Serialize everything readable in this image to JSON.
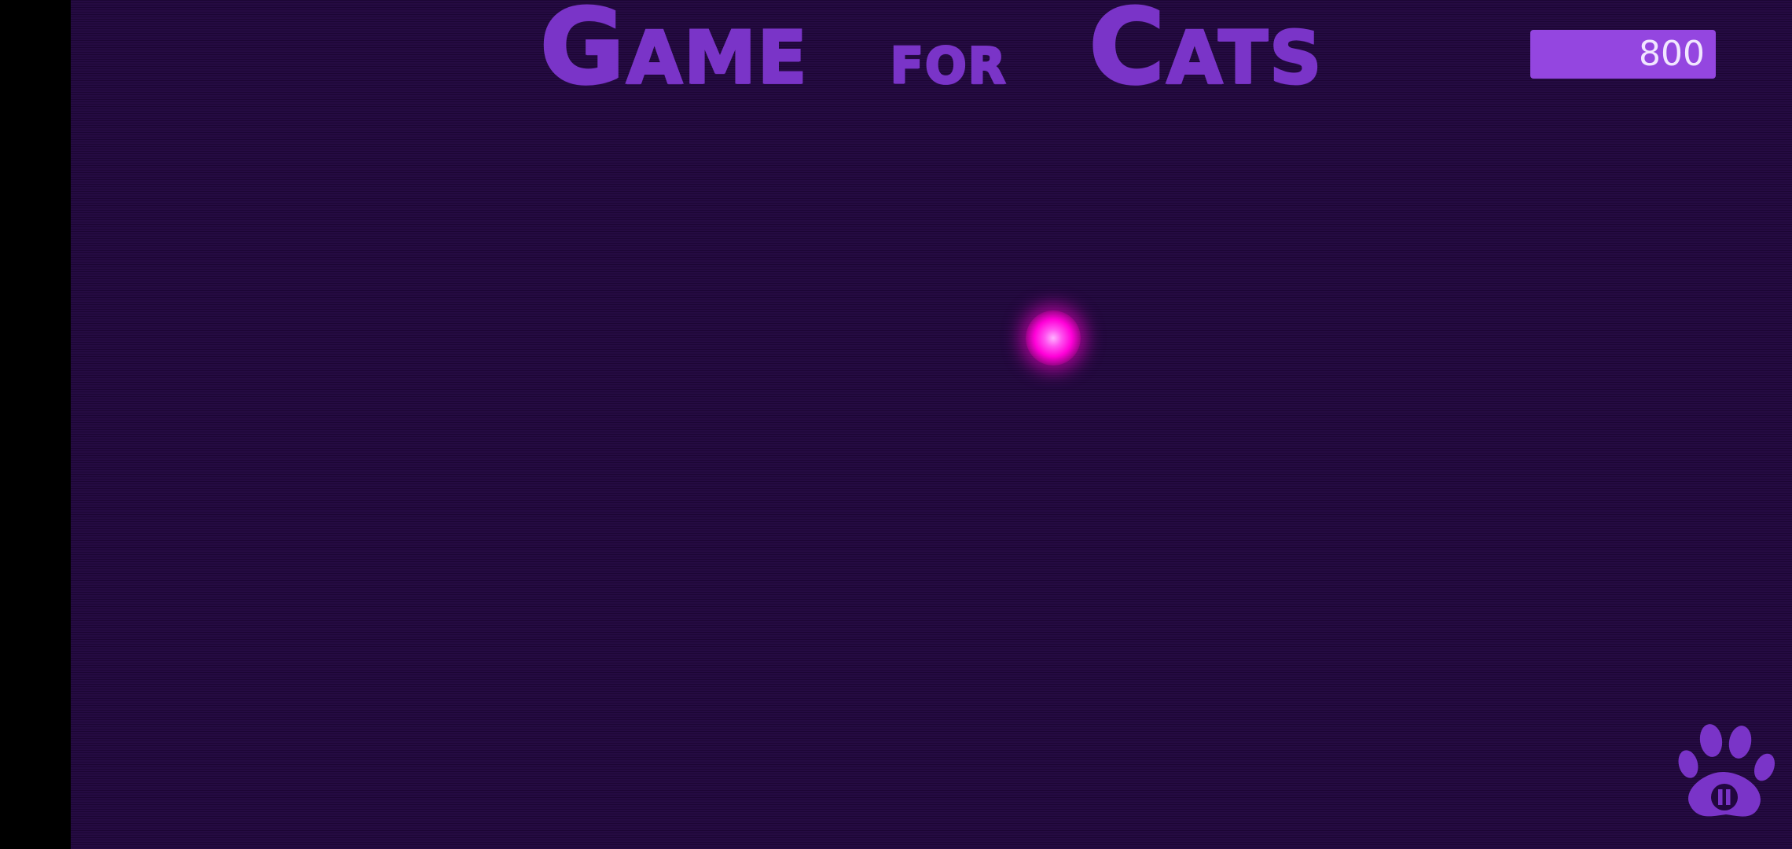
{
  "title": {
    "word1": "Game",
    "word2": "for",
    "word3": "Cats"
  },
  "score": "800",
  "colors": {
    "background": "#22073f",
    "title": "#7a34c8",
    "score_box": "#9446e0",
    "score_text": "#f1e6ff",
    "laser_dot": "#ff00d8",
    "paw": "#7a34c8"
  },
  "icons": {
    "target": "laser-dot",
    "pause": "paw-pause-icon"
  }
}
